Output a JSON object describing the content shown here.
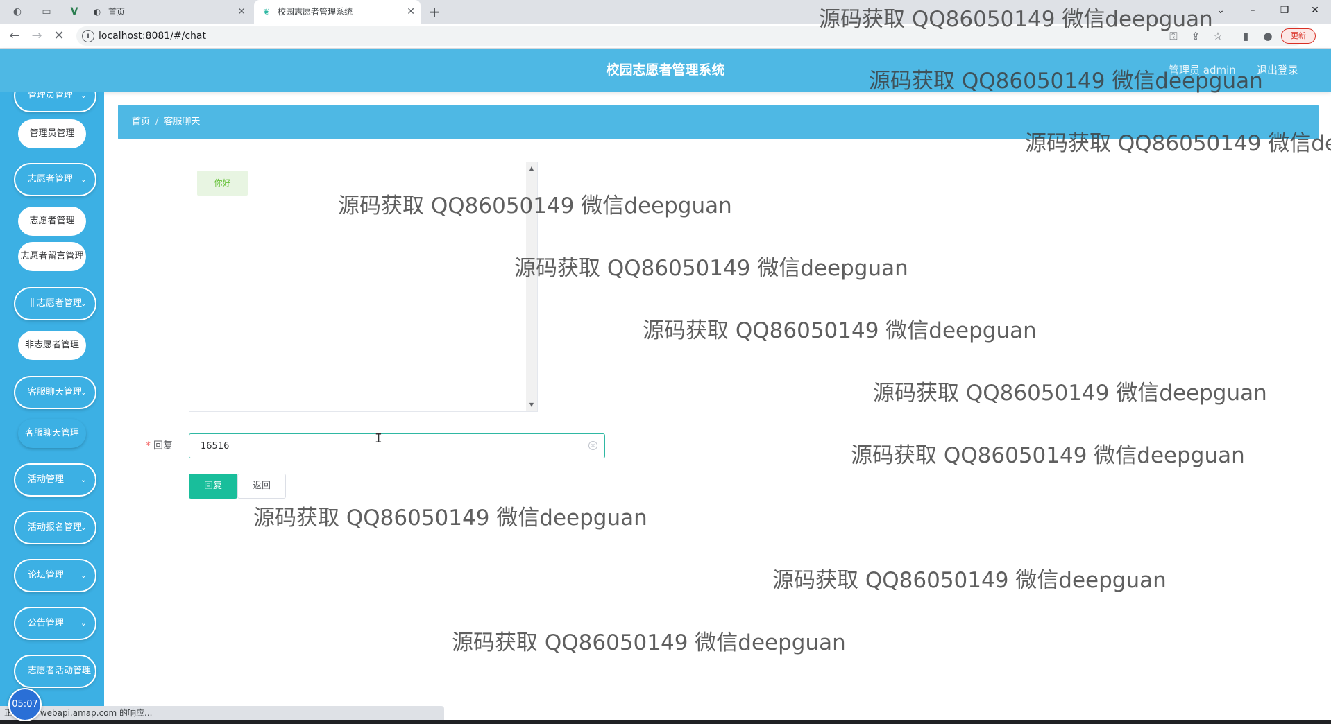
{
  "browser": {
    "tabs": [
      {
        "title": "首页",
        "favicon": "globe-icon"
      },
      {
        "title": "校园志愿者管理系统",
        "favicon": "app-leaf-icon"
      }
    ],
    "url": "localhost:8081/#/chat",
    "update_label": "更新"
  },
  "header": {
    "title": "校园志愿者管理系统",
    "user": "管理员 admin",
    "logout": "退出登录"
  },
  "sidebar": {
    "groups": [
      {
        "label": "管理员管理"
      },
      {
        "label": "志愿者管理"
      },
      {
        "label": "非志愿者管理"
      },
      {
        "label": "客服聊天管理"
      },
      {
        "label": "活动管理"
      },
      {
        "label": "活动报名管理"
      },
      {
        "label": "论坛管理"
      },
      {
        "label": "公告管理"
      },
      {
        "label": "志愿者活动管理"
      }
    ],
    "items": [
      {
        "label": "管理员管理"
      },
      {
        "label": "志愿者管理"
      },
      {
        "label": "志愿者留言管理"
      },
      {
        "label": "非志愿者管理"
      },
      {
        "label": "客服聊天管理"
      }
    ]
  },
  "breadcrumb": {
    "home": "首页",
    "current": "客服聊天"
  },
  "chat": {
    "messages": [
      {
        "text": "你好"
      }
    ]
  },
  "form": {
    "reply_label": "回复",
    "reply_value": "16516",
    "reply_button": "回复",
    "back_button": "返回"
  },
  "status": {
    "text": "正在等待 webapi.amap.com 的响应...",
    "clock": "05:07"
  },
  "watermark": {
    "text": "源码获取 QQ86050149 微信deepguan"
  },
  "colors": {
    "primary": "#4eb8e4",
    "sidebar": "#3cb0e4",
    "reply_button": "#19be9b",
    "input_border": "#2fb8a3"
  }
}
